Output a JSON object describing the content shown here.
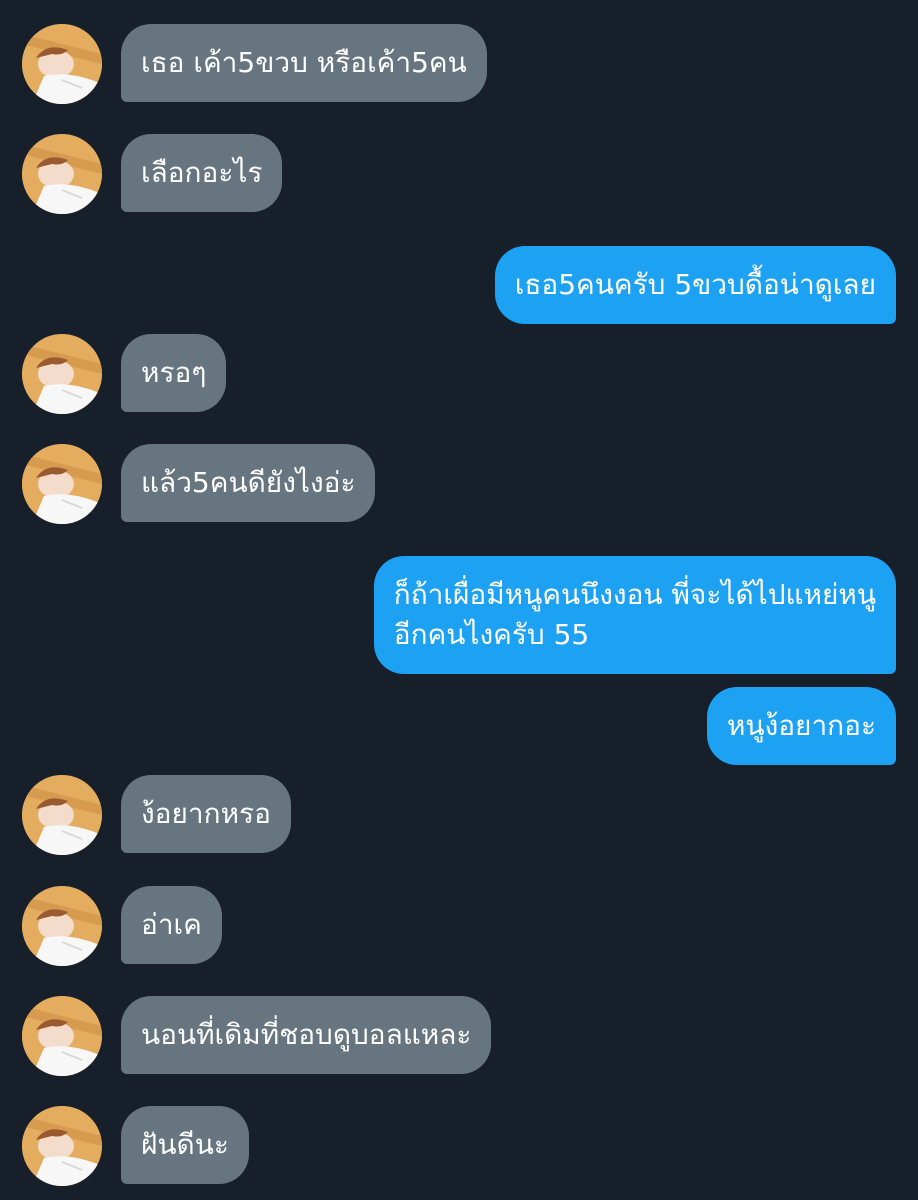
{
  "messages": [
    {
      "side": "in",
      "text": "เธอ เค้า5ขวบ หรือเค้า5คน"
    },
    {
      "side": "in",
      "text": "เลือกอะไร"
    },
    {
      "side": "out",
      "text": "เธอ5คนครับ 5ขวบดื้อน่าดูเลย"
    },
    {
      "side": "in",
      "text": "หรอๆ"
    },
    {
      "side": "in",
      "text": "แล้ว5คนดียังไงอ่ะ"
    },
    {
      "side": "out",
      "lines": [
        "ก็ถ้าเผื่อมีหนูคนนึงงอน พี่จะได้ไปแหย่หนู",
        "อีกคนไงครับ 55"
      ]
    },
    {
      "side": "out",
      "text": "หนูง้อยากอะ"
    },
    {
      "side": "in",
      "text": "ง้อยากหรอ"
    },
    {
      "side": "in",
      "text": "อ่าเค"
    },
    {
      "side": "in",
      "text": "นอนที่เดิมที่ชอบดูบอลแหละ"
    },
    {
      "side": "in",
      "text": "ฝันดีนะ"
    }
  ],
  "colors": {
    "background": "#17202a",
    "incoming_bubble": "#66757f",
    "outgoing_bubble": "#1da1f2",
    "text": "#ffffff"
  },
  "avatar": {
    "icon": "user-avatar-photo"
  }
}
